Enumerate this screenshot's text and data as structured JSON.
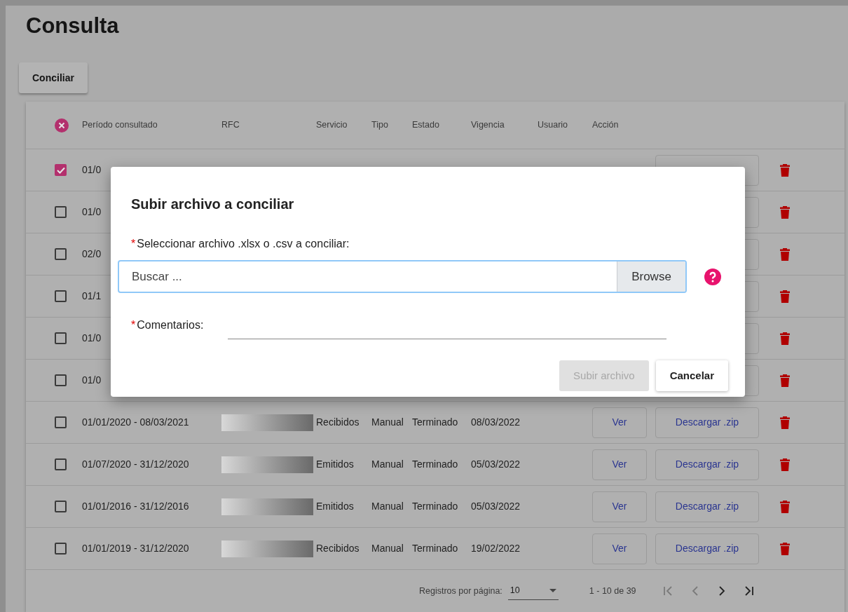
{
  "title": "Consulta",
  "conciliar_button": "Conciliar",
  "table": {
    "columns": [
      "Período consultado",
      "RFC",
      "Servicio",
      "Tipo",
      "Estado",
      "Vigencia",
      "Usuario",
      "Acción"
    ],
    "rows": [
      {
        "selected": true,
        "kind": "covered",
        "period": "01/0"
      },
      {
        "selected": false,
        "kind": "covered",
        "period": "01/0"
      },
      {
        "selected": false,
        "kind": "covered",
        "period": "02/0"
      },
      {
        "selected": false,
        "kind": "covered",
        "period": "01/1"
      },
      {
        "selected": false,
        "kind": "covered",
        "period": "01/0"
      },
      {
        "selected": false,
        "kind": "covered",
        "period": "01/0"
      },
      {
        "selected": false,
        "kind": "full",
        "period": "01/01/2020 - 08/03/2021",
        "servicio": "Recibidos",
        "tipo": "Manual",
        "estado": "Terminado",
        "vigencia": "08/03/2022",
        "ver": "Ver",
        "download": "Descargar .zip"
      },
      {
        "selected": false,
        "kind": "full",
        "period": "01/07/2020 - 31/12/2020",
        "servicio": "Emitidos",
        "tipo": "Manual",
        "estado": "Terminado",
        "vigencia": "05/03/2022",
        "ver": "Ver",
        "download": "Descargar .zip"
      },
      {
        "selected": false,
        "kind": "full",
        "period": "01/01/2016 - 31/12/2016",
        "servicio": "Emitidos",
        "tipo": "Manual",
        "estado": "Terminado",
        "vigencia": "05/03/2022",
        "ver": "Ver",
        "download": "Descargar .zip"
      },
      {
        "selected": false,
        "kind": "full",
        "period": "01/01/2019 - 31/12/2020",
        "servicio": "Recibidos",
        "tipo": "Manual",
        "estado": "Terminado",
        "vigencia": "19/02/2022",
        "ver": "Ver",
        "download": "Descargar .zip"
      }
    ]
  },
  "pagination": {
    "label": "Registros por página:",
    "per_page": "10",
    "range": "1 - 10 de 39"
  },
  "dialog": {
    "title": "Subir archivo a conciliar",
    "required_mark": "*",
    "file_label": "Seleccionar archivo .xlsx o .csv a conciliar:",
    "file_placeholder": "Buscar ...",
    "browse": "Browse",
    "comments_label": "Comentarios:",
    "submit": {
      "label": "Subir archivo",
      "disabled": true
    },
    "cancel": "Cancelar"
  }
}
